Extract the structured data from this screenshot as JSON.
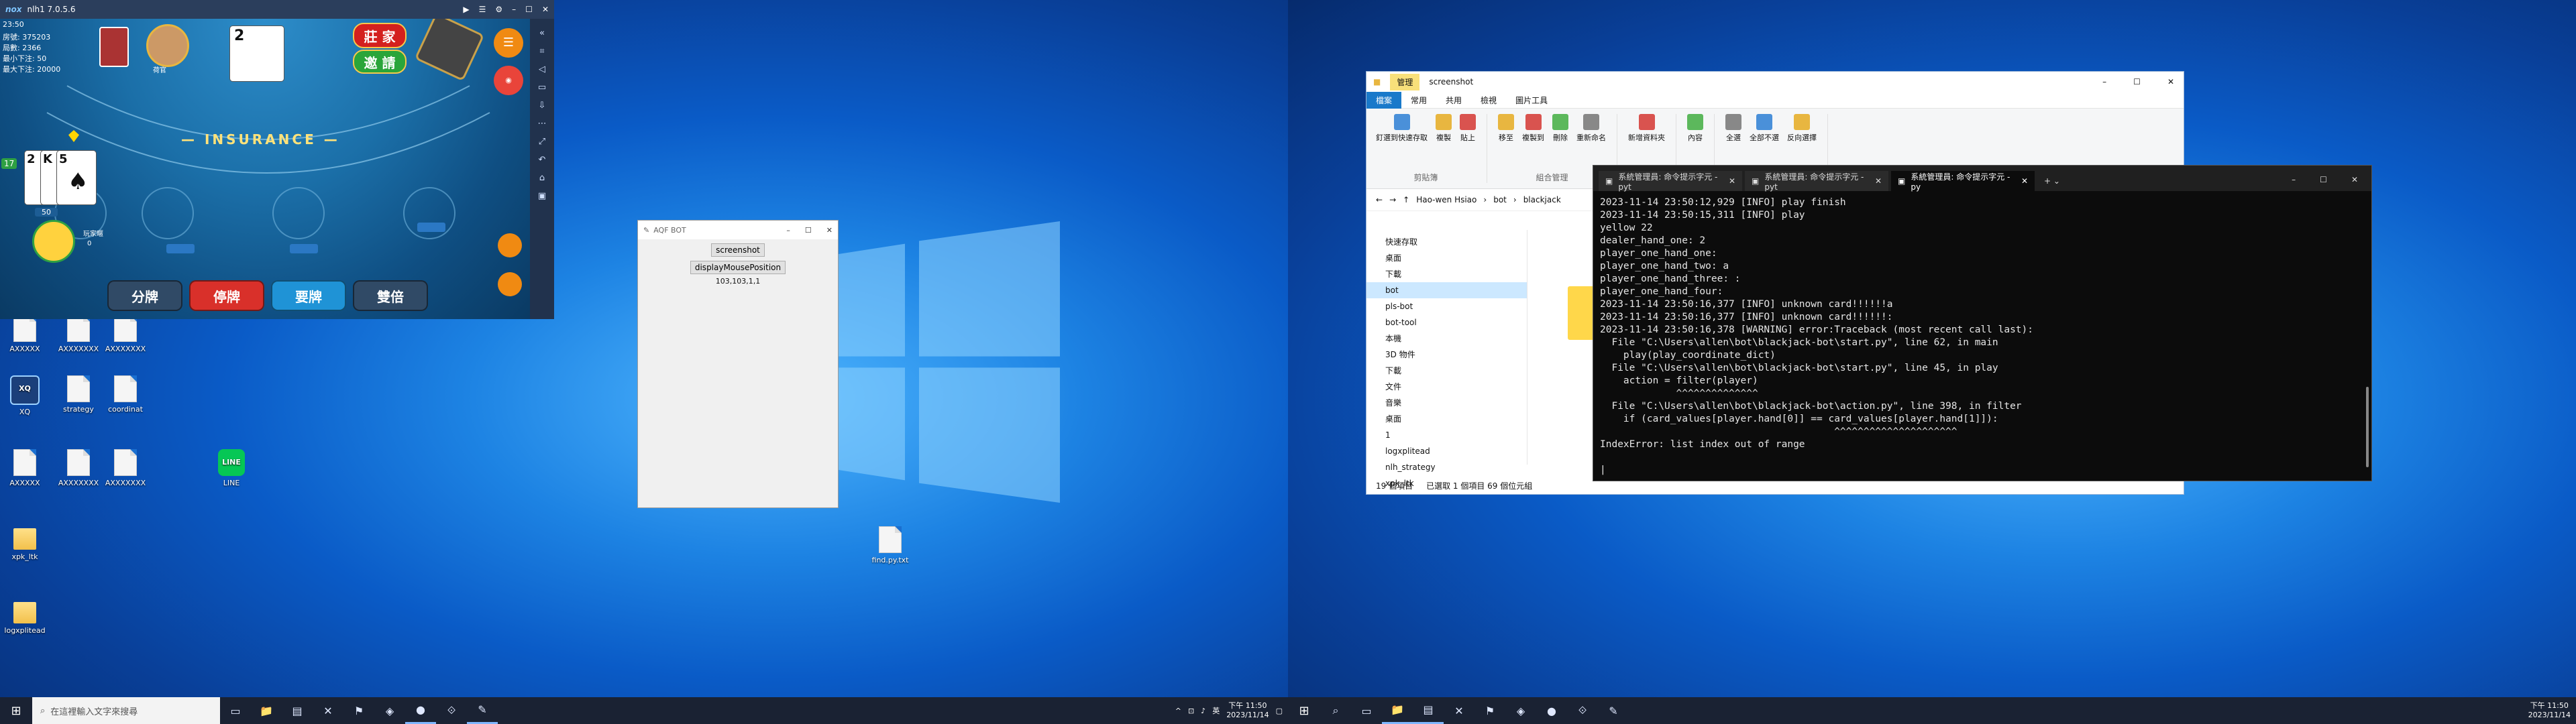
{
  "left": {
    "taskbar": {
      "search_placeholder": "在這裡輸入文字來搜尋",
      "tray_lang": "英",
      "time": "下午 11:50",
      "date": "2023/11/14"
    },
    "nox": {
      "app_name": "nox",
      "title": "nlh1 7.0.5.6",
      "game": {
        "time": "23:50",
        "stats": [
          "房號: 375203",
          "局數: 2366",
          "最小下注: 50",
          "最大下注: 20000"
        ],
        "dealer_card": "2",
        "dealer_name": "荷官",
        "btn_close": "莊 家",
        "btn_invite": "邀 請",
        "insurance_text": "— INSURANCE —",
        "player_cards": [
          "2",
          "K",
          "5"
        ],
        "player_total": "17",
        "bet_amount": "50",
        "player_name": "玩家暱",
        "player_balance": "0",
        "btn_split": "分牌",
        "btn_stand": "停牌",
        "btn_hit": "要牌",
        "btn_double": "雙倍"
      }
    },
    "aqf": {
      "title": "AQF BOT",
      "btn_screenshot": "screenshot",
      "btn_display": "displayMousePosition",
      "coords": "103,103,1,1"
    },
    "desktop_icons": [
      {
        "label": "AXXXXX",
        "type": "doc"
      },
      {
        "label": "AXXXXXXX",
        "type": "doc"
      },
      {
        "label": "AXXXXXXX",
        "type": "doc"
      },
      {
        "label": "XQ",
        "type": "xq"
      },
      {
        "label": "strategy",
        "type": "doc"
      },
      {
        "label": "coordinat",
        "type": "doc"
      },
      {
        "label": "AXXXXX",
        "type": "doc"
      },
      {
        "label": "AXXXXXXX",
        "type": "doc"
      },
      {
        "label": "AXXXXXXX",
        "type": "doc"
      },
      {
        "label": "LINE",
        "type": "line"
      },
      {
        "label": "xpk_ltk",
        "type": "folder"
      },
      {
        "label": "logxplitead",
        "type": "folder"
      },
      {
        "label": "find.py.txt",
        "type": "doc"
      }
    ]
  },
  "right": {
    "taskbar": {
      "time": "下午 11:50",
      "date": "2023/11/14"
    },
    "explorer": {
      "title_mgmt": "管理",
      "title_name": "screenshot",
      "tabs": [
        "檔案",
        "常用",
        "共用",
        "檢視",
        "圖片工具"
      ],
      "ribbon_groups": [
        {
          "label": "剪貼簿",
          "items": [
            "釘選到快速存取",
            "複製",
            "貼上"
          ]
        },
        {
          "label": "組合管理",
          "items": [
            "移至",
            "複製到",
            "刪除",
            "重新命名"
          ]
        },
        {
          "label": "新增",
          "items": [
            "新增資料夾"
          ]
        },
        {
          "label": "開啟",
          "items": [
            "內容"
          ]
        },
        {
          "label": "選取",
          "items": [
            "全選",
            "全部不選",
            "反向選擇"
          ]
        }
      ],
      "path": [
        "Hao-wen Hsiao",
        "bot",
        "blackjack"
      ],
      "nav": [
        "快速存取",
        "桌面",
        "下載",
        "bot",
        "pls-bot",
        "bot-tool",
        "本機",
        "3D 物件",
        "下載",
        "文件",
        "音樂",
        "桌面",
        "1",
        "logxplitead",
        "nlh_strategy",
        "xpk_ltk"
      ],
      "status": [
        "19 個項目",
        "已選取 1 個項目 69 個位元組"
      ]
    },
    "terminal": {
      "tabs": [
        "系統管理員: 命令提示字元 - pyt",
        "系統管理員: 命令提示字元 - pyt",
        "系統管理員: 命令提示字元 - py"
      ],
      "lines": [
        "2023-11-14 23:50:12,929 [INFO] play finish",
        "2023-11-14 23:50:15,311 [INFO] play",
        "yellow 22",
        "dealer_hand_one: 2",
        "player_one_hand_one:",
        "player_one_hand_two: a",
        "player_one_hand_three: :",
        "player_one_hand_four:",
        "2023-11-14 23:50:16,377 [INFO] unknown card!!!!!!a",
        "2023-11-14 23:50:16,377 [INFO] unknown card!!!!!!:",
        "2023-11-14 23:50:16,378 [WARNING] error:Traceback (most recent call last):",
        "  File \"C:\\Users\\allen\\bot\\blackjack-bot\\start.py\", line 62, in main",
        "    play(play_coordinate_dict)",
        "  File \"C:\\Users\\allen\\bot\\blackjack-bot\\start.py\", line 45, in play",
        "    action = filter(player)",
        "             ^^^^^^^^^^^^^^",
        "  File \"C:\\Users\\allen\\bot\\blackjack-bot\\action.py\", line 398, in filter",
        "    if (card_values[player.hand[0]] == card_values[player.hand[1]]):",
        "                                        ^^^^^^^^^^^^^^^^^^^^^",
        "IndexError: list index out of range",
        "",
        "|"
      ]
    }
  }
}
